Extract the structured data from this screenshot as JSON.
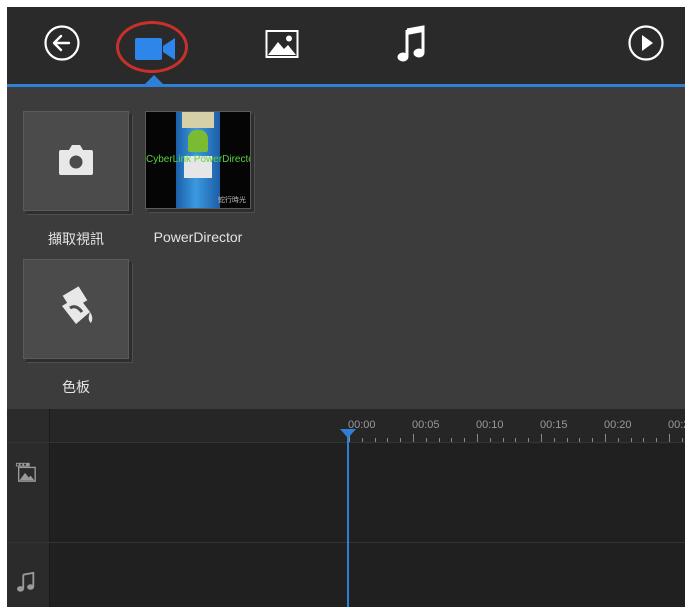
{
  "toolbar": {
    "buttons": [
      {
        "name": "back",
        "icon": "back-arrow-icon"
      },
      {
        "name": "video",
        "icon": "video-camera-icon",
        "selected": true
      },
      {
        "name": "photo",
        "icon": "image-icon"
      },
      {
        "name": "music",
        "icon": "music-note-icon"
      },
      {
        "name": "play",
        "icon": "play-icon"
      }
    ],
    "accent_color": "#2f7fd6",
    "annotation_color": "#c9302c"
  },
  "library": {
    "items": [
      {
        "label": "擷取視訊",
        "icon": "camera-icon"
      },
      {
        "label": "PowerDirector",
        "thumbnail_text": "CyberLink PowerDirector",
        "thumbnail_corner": "蛇行時光"
      },
      {
        "label": "色板",
        "icon": "paint-bucket-icon"
      }
    ]
  },
  "timeline": {
    "ticks": [
      "00:00",
      "00:05",
      "00:10",
      "00:15",
      "00:20",
      "00:2"
    ],
    "tracks": [
      {
        "icon": "video-track-icon"
      },
      {
        "icon": "music-track-icon"
      }
    ]
  }
}
